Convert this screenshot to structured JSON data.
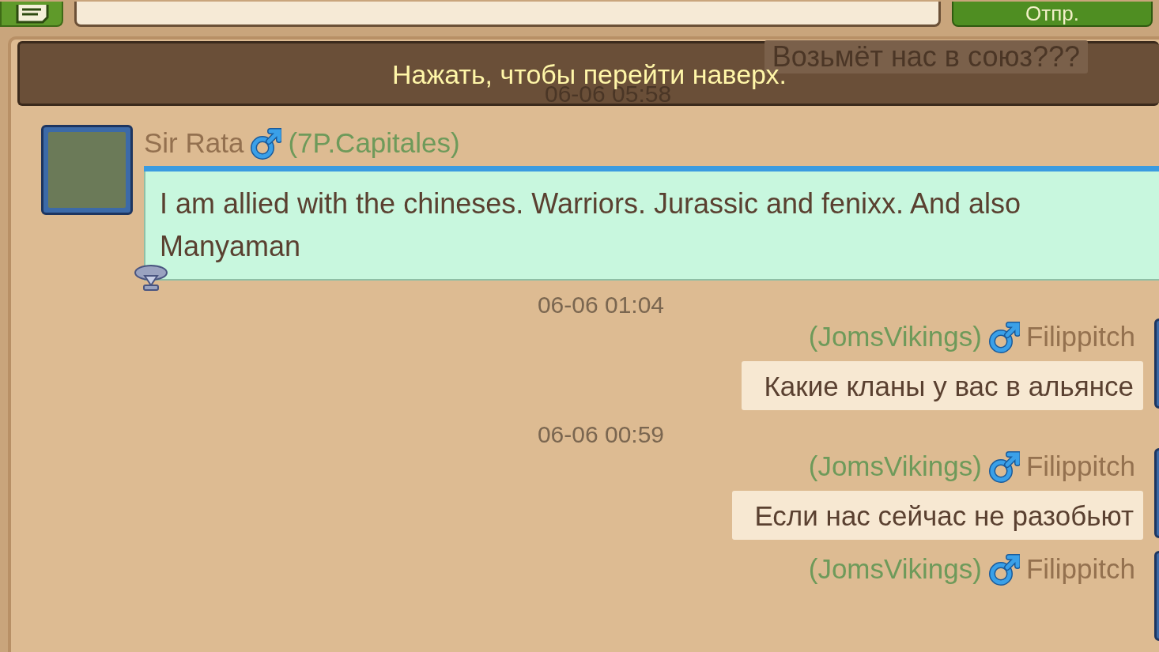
{
  "top_bar": {
    "send_button": "Отпр."
  },
  "banner": {
    "text": "Нажать, чтобы перейти наверх.",
    "faded_message": "Возьмёт нас в союз???",
    "faded_time": "06-06 05:58"
  },
  "feed": [
    {
      "kind": "incoming",
      "name": "Sir Rata",
      "male": true,
      "clan": "(7P.Capitales)",
      "vip": true,
      "text": "I am allied with the chineses. Warriors. Jurassic and fenixx. And also Manyaman"
    },
    {
      "kind": "time",
      "text": "06-06 01:04"
    },
    {
      "kind": "outgoing",
      "name": "Filippitch",
      "male": true,
      "clan": "(JomsVikings)",
      "vip": false,
      "text": "Какие кланы у вас в альянсе"
    },
    {
      "kind": "time",
      "text": "06-06 00:59"
    },
    {
      "kind": "outgoing",
      "name": "Filippitch",
      "male": true,
      "clan": "(JomsVikings)",
      "vip": false,
      "text": "Если нас сейчас не разобьют"
    },
    {
      "kind": "outgoing",
      "name": "Filippitch",
      "male": true,
      "clan": "(JomsVikings)",
      "vip": false
    }
  ]
}
